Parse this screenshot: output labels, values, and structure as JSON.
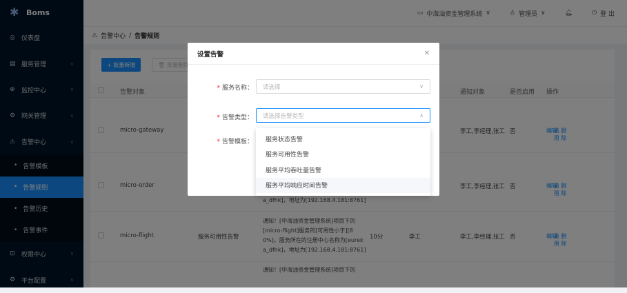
{
  "app": {
    "name": "Boms"
  },
  "sidebar": {
    "items": [
      {
        "label": "仪表盘",
        "icon": "dashboard-icon"
      },
      {
        "label": "服务管理",
        "icon": "server-icon"
      },
      {
        "label": "监控中心",
        "icon": "monitor-icon"
      },
      {
        "label": "网关管理",
        "icon": "gateway-icon"
      },
      {
        "label": "告警中心",
        "icon": "warning-icon"
      }
    ],
    "sub_items": [
      {
        "label": "告警模板"
      },
      {
        "label": "告警规则"
      },
      {
        "label": "告警历史"
      },
      {
        "label": "告警事件"
      }
    ],
    "bottom_items": [
      {
        "label": "权限中心",
        "icon": "lock-icon"
      },
      {
        "label": "平台配置",
        "icon": "settings-icon"
      }
    ]
  },
  "header": {
    "system": "中海油资金管理系统",
    "user": "管理员",
    "logout": "登 出"
  },
  "breadcrumb": {
    "root": "告警中心",
    "sep": "/",
    "current": "告警规则"
  },
  "toolbar": {
    "add": "+ 批量新增",
    "delete": "批量删除"
  },
  "table": {
    "headers": [
      "告警对象",
      "通知对象",
      "是否启用",
      "操作"
    ],
    "rows": [
      {
        "object": "micro-gateway",
        "notify": "李工,李经理,张工",
        "enabled": "否"
      },
      {
        "object": "micro-order",
        "notify": "李工,李经理,张工",
        "enabled": "否",
        "note_tail": "a_dfhk]，地址为[192.168.4.181:8761]"
      },
      {
        "object": "micro-flight",
        "type": "服务可用性告警",
        "note": [
          "通知！[中海油资金管理系统]项目下的",
          "[micro-flight]服务的[可用性小于][8",
          "0%]，服务所在的注册中心名称为[eurek",
          "a_dfhk]，地址为[192.168.4.181:8761]"
        ],
        "interval": "10分",
        "person": "李工",
        "notify": "李工,李经理,张工",
        "enabled": "否"
      },
      {
        "note": [
          "通知！[中海油资金管理系统]项目下的"
        ]
      }
    ],
    "ops": {
      "edit": "编辑",
      "enable": "启用",
      "delete": "删除"
    }
  },
  "modal": {
    "title": "设置告警",
    "fields": {
      "service": {
        "label": "服务名称：",
        "placeholder": "请选择"
      },
      "alarm_type": {
        "label": "告警类型：",
        "placeholder": "请选择告警类型"
      },
      "template": {
        "label": "告警模板："
      }
    },
    "options": [
      "服务状态告警",
      "服务可用性告警",
      "服务平均吞吐量告警",
      "服务平均响应时间告警"
    ]
  }
}
